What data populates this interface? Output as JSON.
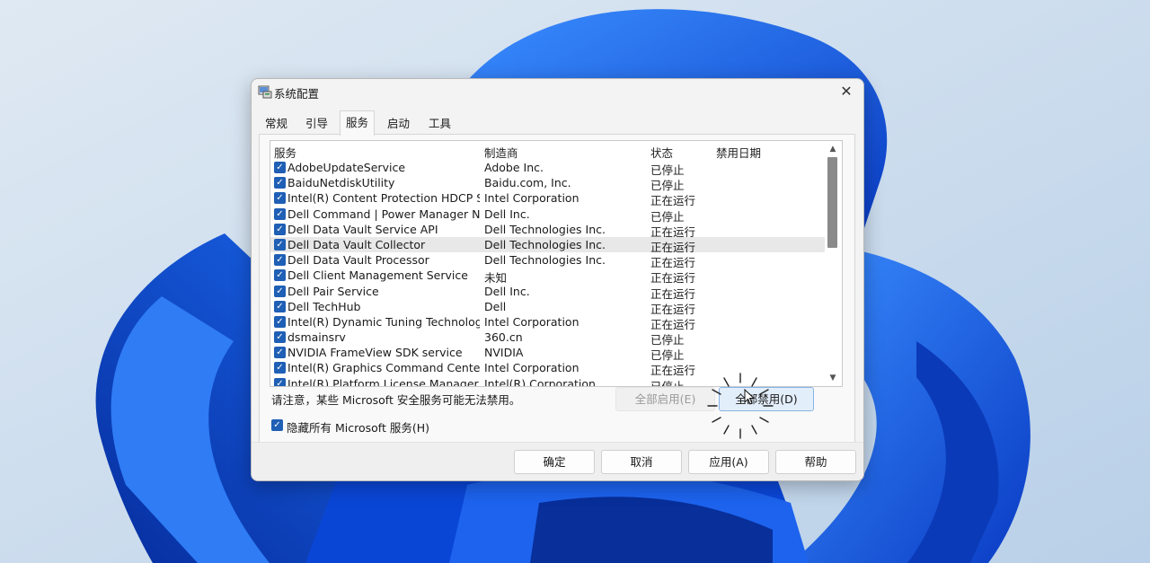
{
  "window": {
    "title": "系统配置",
    "close_glyph": "✕"
  },
  "tabs": [
    {
      "label": "常规"
    },
    {
      "label": "引导"
    },
    {
      "label": "服务",
      "active": true
    },
    {
      "label": "启动"
    },
    {
      "label": "工具"
    }
  ],
  "services": {
    "columns": [
      "服务",
      "制造商",
      "状态",
      "禁用日期"
    ],
    "rows": [
      {
        "name": "AdobeUpdateService",
        "mfr": "Adobe Inc.",
        "status": "已停止",
        "date": "",
        "checked": true
      },
      {
        "name": "BaiduNetdiskUtility",
        "mfr": "Baidu.com, Inc.",
        "status": "已停止",
        "date": "",
        "checked": true
      },
      {
        "name": "Intel(R) Content Protection HDCP Se...",
        "mfr": "Intel Corporation",
        "status": "正在运行",
        "date": "",
        "checked": true
      },
      {
        "name": "Dell Command | Power Manager No...",
        "mfr": "Dell Inc.",
        "status": "已停止",
        "date": "",
        "checked": true
      },
      {
        "name": "Dell Data Vault Service API",
        "mfr": "Dell Technologies Inc.",
        "status": "正在运行",
        "date": "",
        "checked": true
      },
      {
        "name": "Dell Data Vault Collector",
        "mfr": "Dell Technologies Inc.",
        "status": "正在运行",
        "date": "",
        "checked": true,
        "selected": true
      },
      {
        "name": "Dell Data Vault Processor",
        "mfr": "Dell Technologies Inc.",
        "status": "正在运行",
        "date": "",
        "checked": true
      },
      {
        "name": "Dell Client Management Service",
        "mfr": "未知",
        "status": "正在运行",
        "date": "",
        "checked": true
      },
      {
        "name": "Dell Pair Service",
        "mfr": "Dell Inc.",
        "status": "正在运行",
        "date": "",
        "checked": true
      },
      {
        "name": "Dell TechHub",
        "mfr": "Dell",
        "status": "正在运行",
        "date": "",
        "checked": true
      },
      {
        "name": "Intel(R) Dynamic Tuning Technology...",
        "mfr": "Intel Corporation",
        "status": "正在运行",
        "date": "",
        "checked": true
      },
      {
        "name": "dsmainsrv",
        "mfr": "360.cn",
        "status": "已停止",
        "date": "",
        "checked": true
      },
      {
        "name": "NVIDIA FrameView SDK service",
        "mfr": "NVIDIA",
        "status": "已停止",
        "date": "",
        "checked": true
      },
      {
        "name": "Intel(R) Graphics Command Center ...",
        "mfr": "Intel Corporation",
        "status": "正在运行",
        "date": "",
        "checked": true
      },
      {
        "name": "Intel(R) Platform License Manager S...",
        "mfr": "Intel(R) Corporation",
        "status": "已停止",
        "date": "",
        "checked": true
      }
    ]
  },
  "note": "请注意，某些 Microsoft 安全服务可能无法禁用。",
  "buttons": {
    "enable_all": "全部启用(E)",
    "disable_all": "全部禁用(D)",
    "ok": "确定",
    "cancel": "取消",
    "apply": "应用(A)",
    "help": "帮助"
  },
  "hide_ms": {
    "label": "隐藏所有 Microsoft 服务(H)",
    "checked": true
  },
  "colors": {
    "accent": "#1f5fb5",
    "wallpaper_bg": "#c9dcee",
    "bloom": "#1457e0"
  },
  "icons": {
    "checkbox": "✓",
    "scroll_up": "▲",
    "scroll_down": "▼"
  }
}
